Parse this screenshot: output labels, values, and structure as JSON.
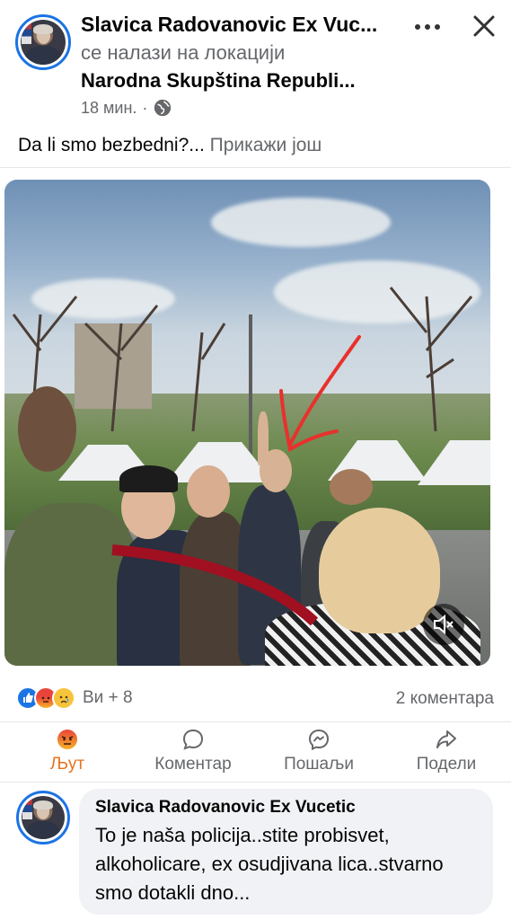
{
  "post": {
    "author": "Slavica Radovanovic Ex Vuc...",
    "location_prefix": "се налази на локацији",
    "location": "Narodna Skupština Republi...",
    "time": "18 мин.",
    "separator": "·",
    "privacy_icon": "globe-icon",
    "text": "Da li smo bezbedni?...",
    "see_more": "Прикажи још"
  },
  "reactions": {
    "icons": [
      "like-icon",
      "angry-icon",
      "sad-icon"
    ],
    "summary": "Ви + 8",
    "comments": "2 коментара"
  },
  "actions": {
    "react": "Љут",
    "comment": "Коментар",
    "send": "Пошаљи",
    "share": "Подели"
  },
  "comment": {
    "author": "Slavica Radovanovic Ex Vucetic",
    "text": "To je naša policija..stite probisvet, alkoholicare, ex osudjivana lica..stvarno smo dotakli dno..."
  },
  "colors": {
    "brand_blue": "#1b74e4",
    "angry_orange": "#e9711c",
    "muted_text": "#65676b",
    "bubble_bg": "#f0f2f5",
    "annotation_red": "#e8312c"
  }
}
